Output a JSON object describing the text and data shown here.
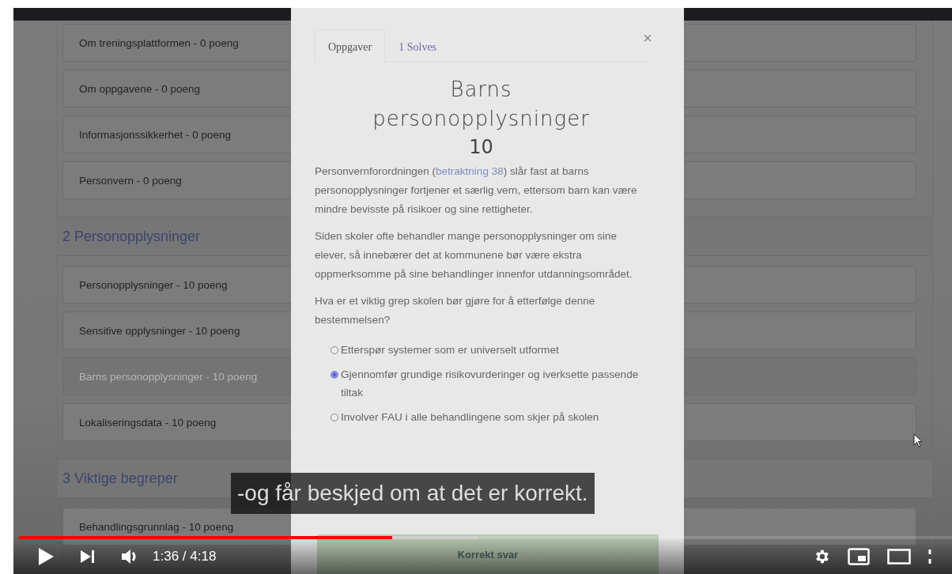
{
  "course": {
    "sections": [
      {
        "items": [
          {
            "label": "Om treningsplattformen - 0 poeng",
            "completed": false
          },
          {
            "label": "Om oppgavene - 0 poeng",
            "completed": false
          },
          {
            "label": "Informasjonssikkerhet - 0 poeng",
            "completed": false
          },
          {
            "label": "Personvern - 0 poeng",
            "completed": false
          }
        ]
      },
      {
        "title": "2 Personopplysninger",
        "items": [
          {
            "label": "Personopplysninger - 10 poeng",
            "completed": false
          },
          {
            "label": "Sensitive opplysninger - 10 poeng",
            "completed": false
          },
          {
            "label": "Barns personopplysninger - 10 poeng",
            "completed": true
          },
          {
            "label": "Lokaliseringsdata - 10 poeng",
            "completed": false
          }
        ]
      },
      {
        "title": "3 Viktige begreper",
        "items": [
          {
            "label": "Behandlingsgrunnlag - 10 poeng",
            "completed": false
          }
        ]
      }
    ]
  },
  "modal": {
    "tabs": [
      {
        "label": "Oppgaver",
        "selected": true
      },
      {
        "label": "1 Solves",
        "selected": false
      }
    ],
    "close": "×",
    "title": "Barns personopplysninger",
    "points": "10",
    "intro": {
      "before": "Personvernforordningen (",
      "link": "betraktning 38",
      "after": ") slår fast at barns personopplysninger fortjener et særlig vern, ettersom barn kan være mindre bevisste på risikoer og sine rettigheter."
    },
    "paragraph": "Siden skoler ofte behandler mange personopplysninger om sine elever, så innebærer det at kommunene bør være ekstra oppmerksomme på sine behandlinger innenfor utdanningsområdet.",
    "question": "Hva er et viktig grep skolen bør gjøre for å etterfølge denne bestemmelsen?",
    "options": [
      {
        "label": "Etterspør systemer som er universelt utformet",
        "selected": false
      },
      {
        "label": "Gjennomfør grundige risikovurderinger og iverksette passende tiltak",
        "selected": true
      },
      {
        "label": "Involver FAU i alle behandlingene som skjer på skolen",
        "selected": false
      }
    ],
    "result_button": "Korrekt svar"
  },
  "subtitle": "-og får beskjed om at det er korrekt.",
  "player": {
    "progress": [
      {
        "kind": "buffered",
        "level": 0.48
      },
      {
        "kind": "played",
        "level": 0.39
      }
    ],
    "time": "1:36 / 4:18"
  }
}
